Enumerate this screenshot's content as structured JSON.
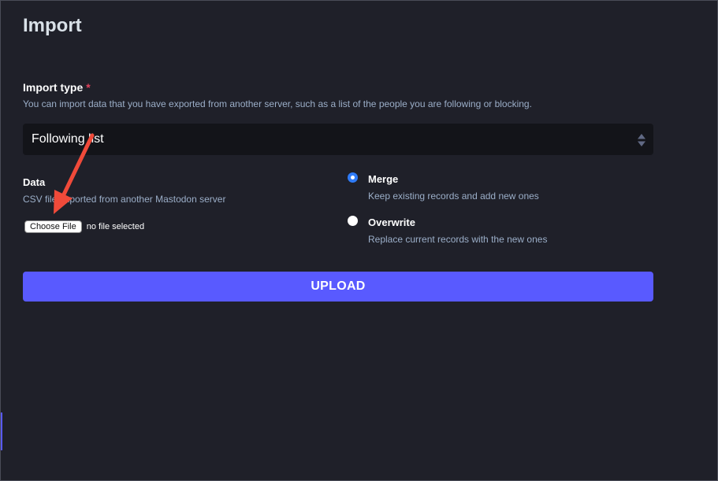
{
  "page": {
    "title": "Import"
  },
  "import_type": {
    "label": "Import type",
    "required_marker": "*",
    "hint": "You can import data that you have exported from another server, such as a list of the people you are following or blocking.",
    "selected_option": "Following list"
  },
  "data_field": {
    "label": "Data",
    "hint": "CSV file exported from another Mastodon server",
    "choose_button_label": "Choose File",
    "file_status": "no file selected"
  },
  "mode": {
    "options": [
      {
        "label": "Merge",
        "hint": "Keep existing records and add new ones",
        "checked": true
      },
      {
        "label": "Overwrite",
        "hint": "Replace current records with the new ones",
        "checked": false
      }
    ]
  },
  "upload": {
    "label": "UPLOAD"
  },
  "colors": {
    "background": "#1f2029",
    "accent": "#595aff",
    "required": "#df405a",
    "annotation_arrow": "#f04a3a"
  },
  "icons": {
    "select_arrows": "sort-arrows-icon",
    "annotation": "red-arrow-icon"
  }
}
